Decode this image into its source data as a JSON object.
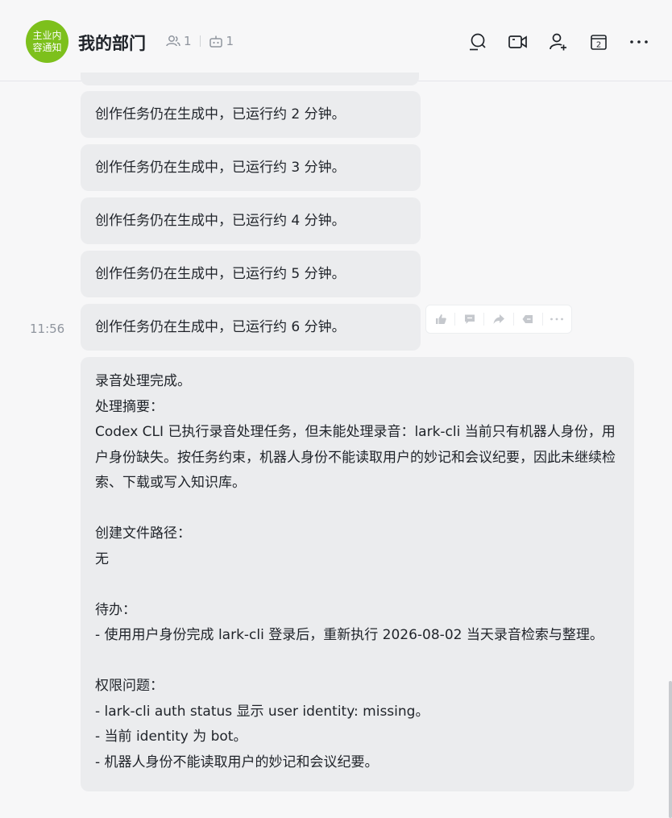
{
  "header": {
    "avatar_text": "主业内容通知",
    "title": "我的部门",
    "member_count": "1",
    "bot_count": "1",
    "avatar_color": "#7dc01c"
  },
  "toolbar": {
    "icons": [
      "search-icon",
      "video-icon",
      "add-member-icon",
      "calendar-icon",
      "more-icon"
    ],
    "calendar_day": "2"
  },
  "messages": {
    "progress": [
      "创作任务仍在生成中，已运行约 2 分钟。",
      "创作任务仍在生成中，已运行约 3 分钟。",
      "创作任务仍在生成中，已运行约 4 分钟。",
      "创作任务仍在生成中，已运行约 5 分钟。",
      "创作任务仍在生成中，已运行约 6 分钟。"
    ],
    "timestamp": "11:56",
    "final": "录音处理完成。\n处理摘要：\nCodex CLI 已执行录音处理任务，但未能处理录音：lark-cli 当前只有机器人身份，用户身份缺失。按任务约束，机器人身份不能读取用户的妙记和会议纪要，因此未继续检索、下载或写入知识库。\n\n创建文件路径：\n无\n\n待办：\n- 使用用户身份完成 lark-cli 登录后，重新执行 2026-08-02 当天录音检索与整理。\n\n权限问题：\n- lark-cli auth status 显示 user identity: missing。\n- 当前 identity 为 bot。\n- 机器人身份不能读取用户的妙记和会议纪要。"
  },
  "message_actions": [
    "thumbs-up-icon",
    "comment-icon",
    "forward-icon",
    "tag-icon",
    "more-icon"
  ]
}
